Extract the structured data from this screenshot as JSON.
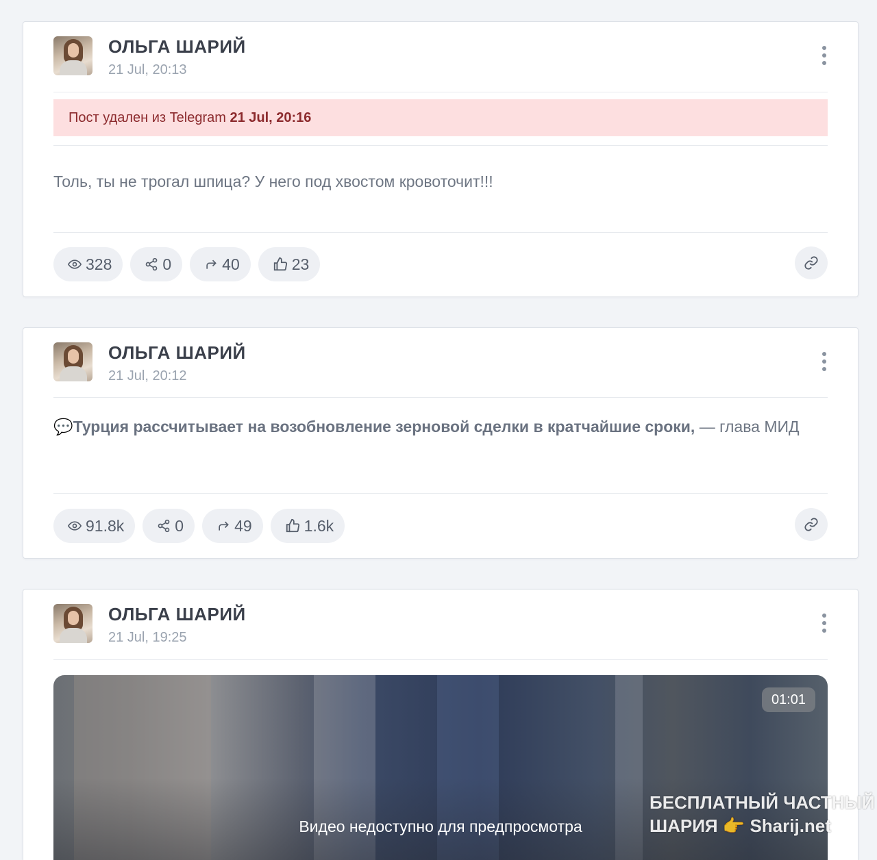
{
  "posts": [
    {
      "author": "ОЛЬГА ШАРИЙ",
      "date": "21 Jul, 20:13",
      "deleted_prefix": "Пост удален из Telegram",
      "deleted_date": "21 Jul, 20:16",
      "text": "Толь, ты не трогал шпица? У него под хвостом кровоточит!!!",
      "stats": {
        "views": "328",
        "shares": "0",
        "forwards": "40",
        "likes": "23"
      }
    },
    {
      "author": "ОЛЬГА ШАРИЙ",
      "date": "21 Jul, 20:12",
      "text_emoji": "💬",
      "text_bold": "Турция рассчитывает на возобновление зерновой сделки в кратчайшие сроки,",
      "text_rest": " — глава МИД",
      "stats": {
        "views": "91.8k",
        "shares": "0",
        "forwards": "49",
        "likes": "1.6k"
      }
    },
    {
      "author": "ОЛЬГА ШАРИЙ",
      "date": "21 Jul, 19:25",
      "video_duration": "01:01",
      "video_unavailable": "Видео недоступно для предпросмотра"
    }
  ],
  "watermark": {
    "line1": "БЕСПЛАТНЫЙ ЧАСТНЫЙ",
    "line2": "ШАРИЯ 👉 Sharij.net"
  },
  "icons": {
    "views": "eye-icon",
    "shares": "share-icon",
    "forwards": "forward-icon",
    "likes": "thumbs-up-icon",
    "link": "link-icon",
    "menu": "kebab-menu-icon"
  }
}
